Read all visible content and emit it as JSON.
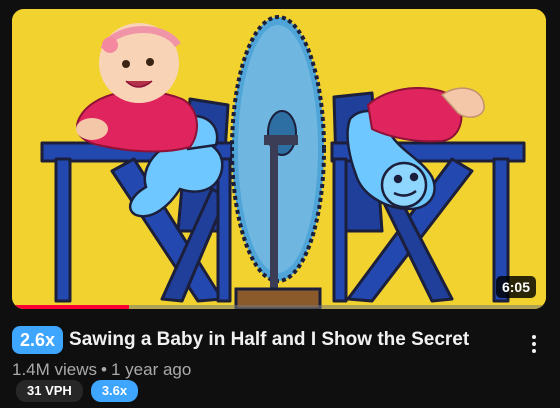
{
  "video": {
    "duration": "6:05",
    "progress_fraction": 0.22,
    "speed_badge": "2.6x",
    "title": "Sawing a Baby in Half and I Show the Secret",
    "views": "1.4M views",
    "separator": "•",
    "age": "1 year ago",
    "vph_chip": "31 VPH",
    "ratio_chip": "3.6x",
    "menu_icon": "more-vert-icon"
  },
  "colors": {
    "thumbnail_background": "#f2d22e",
    "speed_badge": "#3ea6ff",
    "progress": "#ff0033",
    "ratio_chip": "#3ea6ff"
  }
}
